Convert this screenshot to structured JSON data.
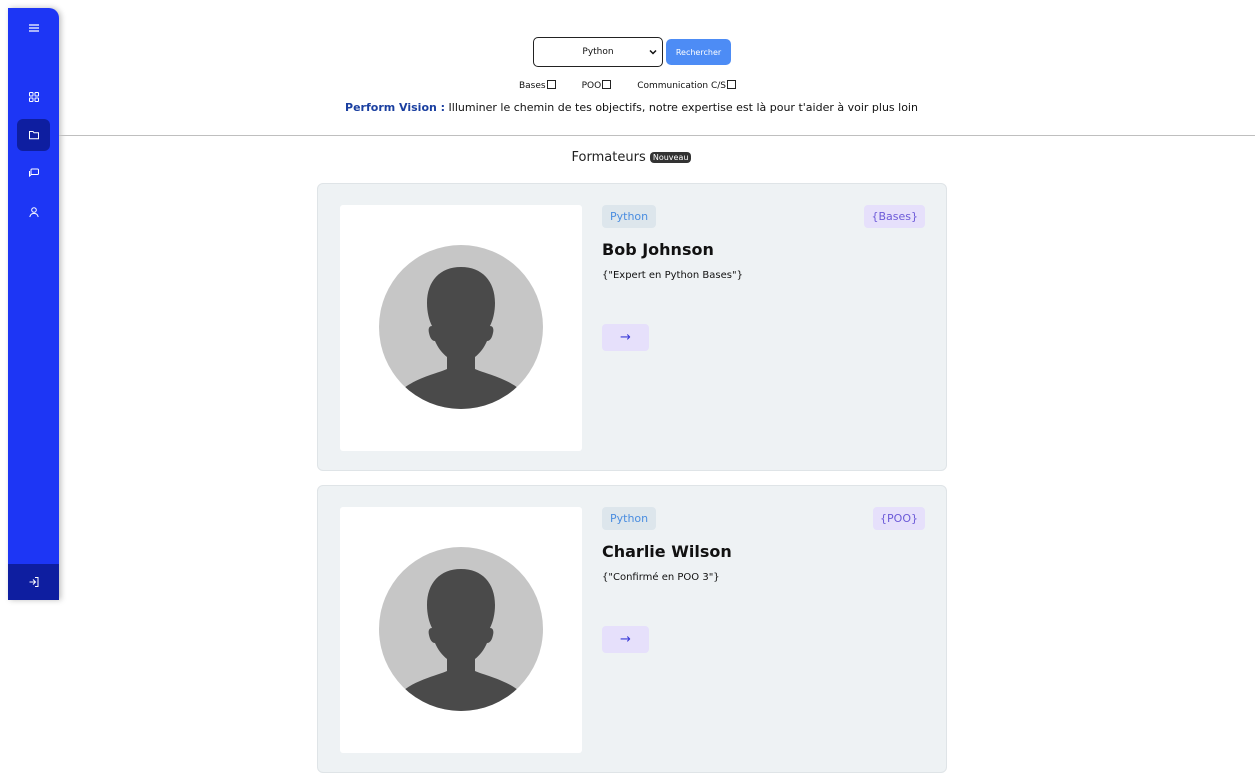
{
  "search": {
    "selected_option": "Python",
    "button_label": "Rechercher"
  },
  "filters": [
    {
      "label": "Bases"
    },
    {
      "label": "POO"
    },
    {
      "label": "Communication C/S"
    }
  ],
  "tagline": {
    "brand": "Perform Vision :",
    "text": " Illuminer le chemin de tes objectifs, notre expertise est là pour t'aider à voir plus loin"
  },
  "section": {
    "title": "Formateurs",
    "badge": "Nouveau"
  },
  "cards": [
    {
      "language": "Python",
      "level": "{Bases}",
      "name": "Bob Johnson",
      "description": "{\"Expert en Python Bases\"}",
      "arrow": "→"
    },
    {
      "language": "Python",
      "level": "{POO}",
      "name": "Charlie Wilson",
      "description": "{\"Confirmé en POO 3\"}",
      "arrow": "→"
    }
  ],
  "colors": {
    "sidebar": "#1d36f5",
    "sidebar_active": "#0e1ea0",
    "search_button": "#4d8cf5",
    "brand_text": "#1a3fa0",
    "card_bg": "#eef2f4"
  },
  "icons": {
    "menu": "menu-icon",
    "dashboard": "grid-icon",
    "folder": "folder-icon",
    "chat": "chat-icon",
    "user": "user-icon",
    "logout": "logout-icon"
  }
}
